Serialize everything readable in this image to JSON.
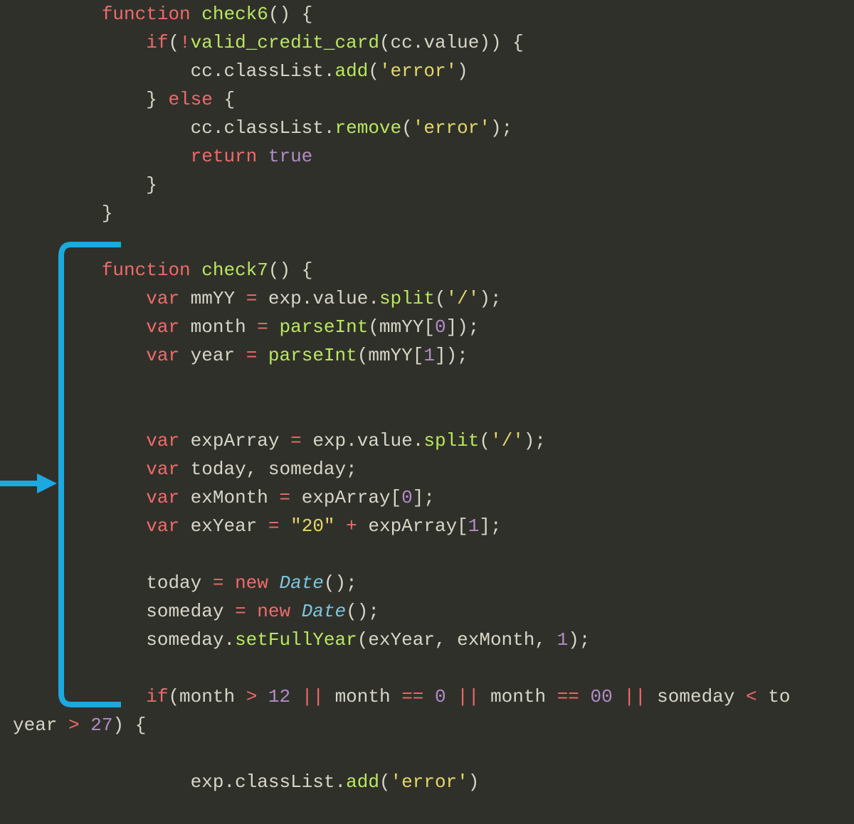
{
  "code": {
    "l1": {
      "ind": "        ",
      "t1": "function",
      "sp1": " ",
      "t2": "check6",
      "t3": "()",
      "sp2": " ",
      "t4": "{"
    },
    "l2": {
      "ind": "            ",
      "t1": "if",
      "t2": "(",
      "t3": "!",
      "t4": "valid_credit_card",
      "t5": "(cc",
      "t6": ".",
      "t7": "value))",
      "sp1": " ",
      "t8": "{"
    },
    "l3": {
      "ind": "                ",
      "t1": "cc",
      "t2": ".",
      "t3": "classList",
      "t4": ".",
      "t5": "add",
      "t6": "(",
      "t7": "'error'",
      "t8": ")"
    },
    "l4": {
      "ind": "            ",
      "t1": "}",
      "sp1": " ",
      "t2": "else",
      "sp2": " ",
      "t3": "{"
    },
    "l5": {
      "ind": "                ",
      "t1": "cc",
      "t2": ".",
      "t3": "classList",
      "t4": ".",
      "t5": "remove",
      "t6": "(",
      "t7": "'error'",
      "t8": ");"
    },
    "l6": {
      "ind": "                ",
      "t1": "return",
      "sp1": " ",
      "t2": "true"
    },
    "l7": {
      "ind": "            ",
      "t1": "}"
    },
    "l8": {
      "ind": "        ",
      "t1": "}"
    },
    "l9": {
      "ind": ""
    },
    "l10": {
      "ind": "        ",
      "t1": "function",
      "sp1": " ",
      "t2": "check7",
      "t3": "()",
      "sp2": " ",
      "t4": "{"
    },
    "l11": {
      "ind": "            ",
      "t1": "var",
      "sp1": " ",
      "t2": "mmYY",
      "sp2": " ",
      "t3": "=",
      "sp3": " ",
      "t4": "exp",
      "t5": ".",
      "t6": "value",
      "t7": ".",
      "t8": "split",
      "t9": "(",
      "t10": "'/'",
      "t11": ");"
    },
    "l12": {
      "ind": "            ",
      "t1": "var",
      "sp1": " ",
      "t2": "month",
      "sp2": " ",
      "t3": "=",
      "sp3": " ",
      "t4": "parseInt",
      "t5": "(mmYY[",
      "t6": "0",
      "t7": "]);"
    },
    "l13": {
      "ind": "            ",
      "t1": "var",
      "sp1": " ",
      "t2": "year",
      "sp2": " ",
      "t3": "=",
      "sp3": " ",
      "t4": "parseInt",
      "t5": "(mmYY[",
      "t6": "1",
      "t7": "]);"
    },
    "l14": {
      "ind": ""
    },
    "l15": {
      "ind": ""
    },
    "l16": {
      "ind": "            ",
      "t1": "var",
      "sp1": " ",
      "t2": "expArray",
      "sp2": " ",
      "t3": "=",
      "sp3": " ",
      "t4": "exp",
      "t5": ".",
      "t6": "value",
      "t7": ".",
      "t8": "split",
      "t9": "(",
      "t10": "'/'",
      "t11": ");"
    },
    "l17": {
      "ind": "            ",
      "t1": "var",
      "sp1": " ",
      "t2": "today,",
      "sp2": " ",
      "t3": "someday;"
    },
    "l18": {
      "ind": "            ",
      "t1": "var",
      "sp1": " ",
      "t2": "exMonth",
      "sp2": " ",
      "t3": "=",
      "sp3": " ",
      "t4": "expArray[",
      "t5": "0",
      "t6": "];"
    },
    "l19": {
      "ind": "            ",
      "t1": "var",
      "sp1": " ",
      "t2": "exYear",
      "sp2": " ",
      "t3": "=",
      "sp3": " ",
      "t4": "\"20\"",
      "sp4": " ",
      "t5": "+",
      "sp5": " ",
      "t6": "expArray[",
      "t7": "1",
      "t8": "];"
    },
    "l20": {
      "ind": ""
    },
    "l21": {
      "ind": "            ",
      "t1": "today",
      "sp1": " ",
      "t2": "=",
      "sp2": " ",
      "t3": "new",
      "sp3": " ",
      "t4": "Date",
      "t5": "();"
    },
    "l22": {
      "ind": "            ",
      "t1": "someday",
      "sp1": " ",
      "t2": "=",
      "sp2": " ",
      "t3": "new",
      "sp3": " ",
      "t4": "Date",
      "t5": "();"
    },
    "l23": {
      "ind": "            ",
      "t1": "someday",
      "t2": ".",
      "t3": "setFullYear",
      "t4": "(exYear,",
      "sp1": " ",
      "t5": "exMonth,",
      "sp2": " ",
      "t6": "1",
      "t7": ");"
    },
    "l24": {
      "ind": ""
    },
    "l25": {
      "ind": "            ",
      "t1": "if",
      "t2": "(month",
      "sp1": " ",
      "t3": ">",
      "sp2": " ",
      "t4": "12",
      "sp3": " ",
      "t5": "||",
      "sp4": " ",
      "t6": "month",
      "sp5": " ",
      "t7": "==",
      "sp6": " ",
      "t8": "0",
      "sp7": " ",
      "t9": "||",
      "sp8": " ",
      "t10": "month",
      "sp9": " ",
      "t11": "==",
      "sp10": " ",
      "t12": "00",
      "sp11": " ",
      "t13": "||",
      "sp12": " ",
      "t14": "someday",
      "sp13": " ",
      "t15": "<",
      "sp14": " ",
      "t16": "to"
    },
    "l26": {
      "ind": "",
      "t1": "year",
      "sp1": " ",
      "t2": ">",
      "sp2": " ",
      "t3": "27",
      "t4": ")",
      "sp3": " ",
      "t5": "{"
    },
    "l27": {
      "ind": ""
    },
    "l28": {
      "ind": "                ",
      "t1": "exp",
      "t2": ".",
      "t3": "classList",
      "t4": ".",
      "t5": "add",
      "t6": "(",
      "t7": "'error'",
      "t8": ")"
    }
  },
  "annotation": {
    "bracket_color": "#1ba9e0",
    "arrow_color": "#1ba9e0"
  }
}
